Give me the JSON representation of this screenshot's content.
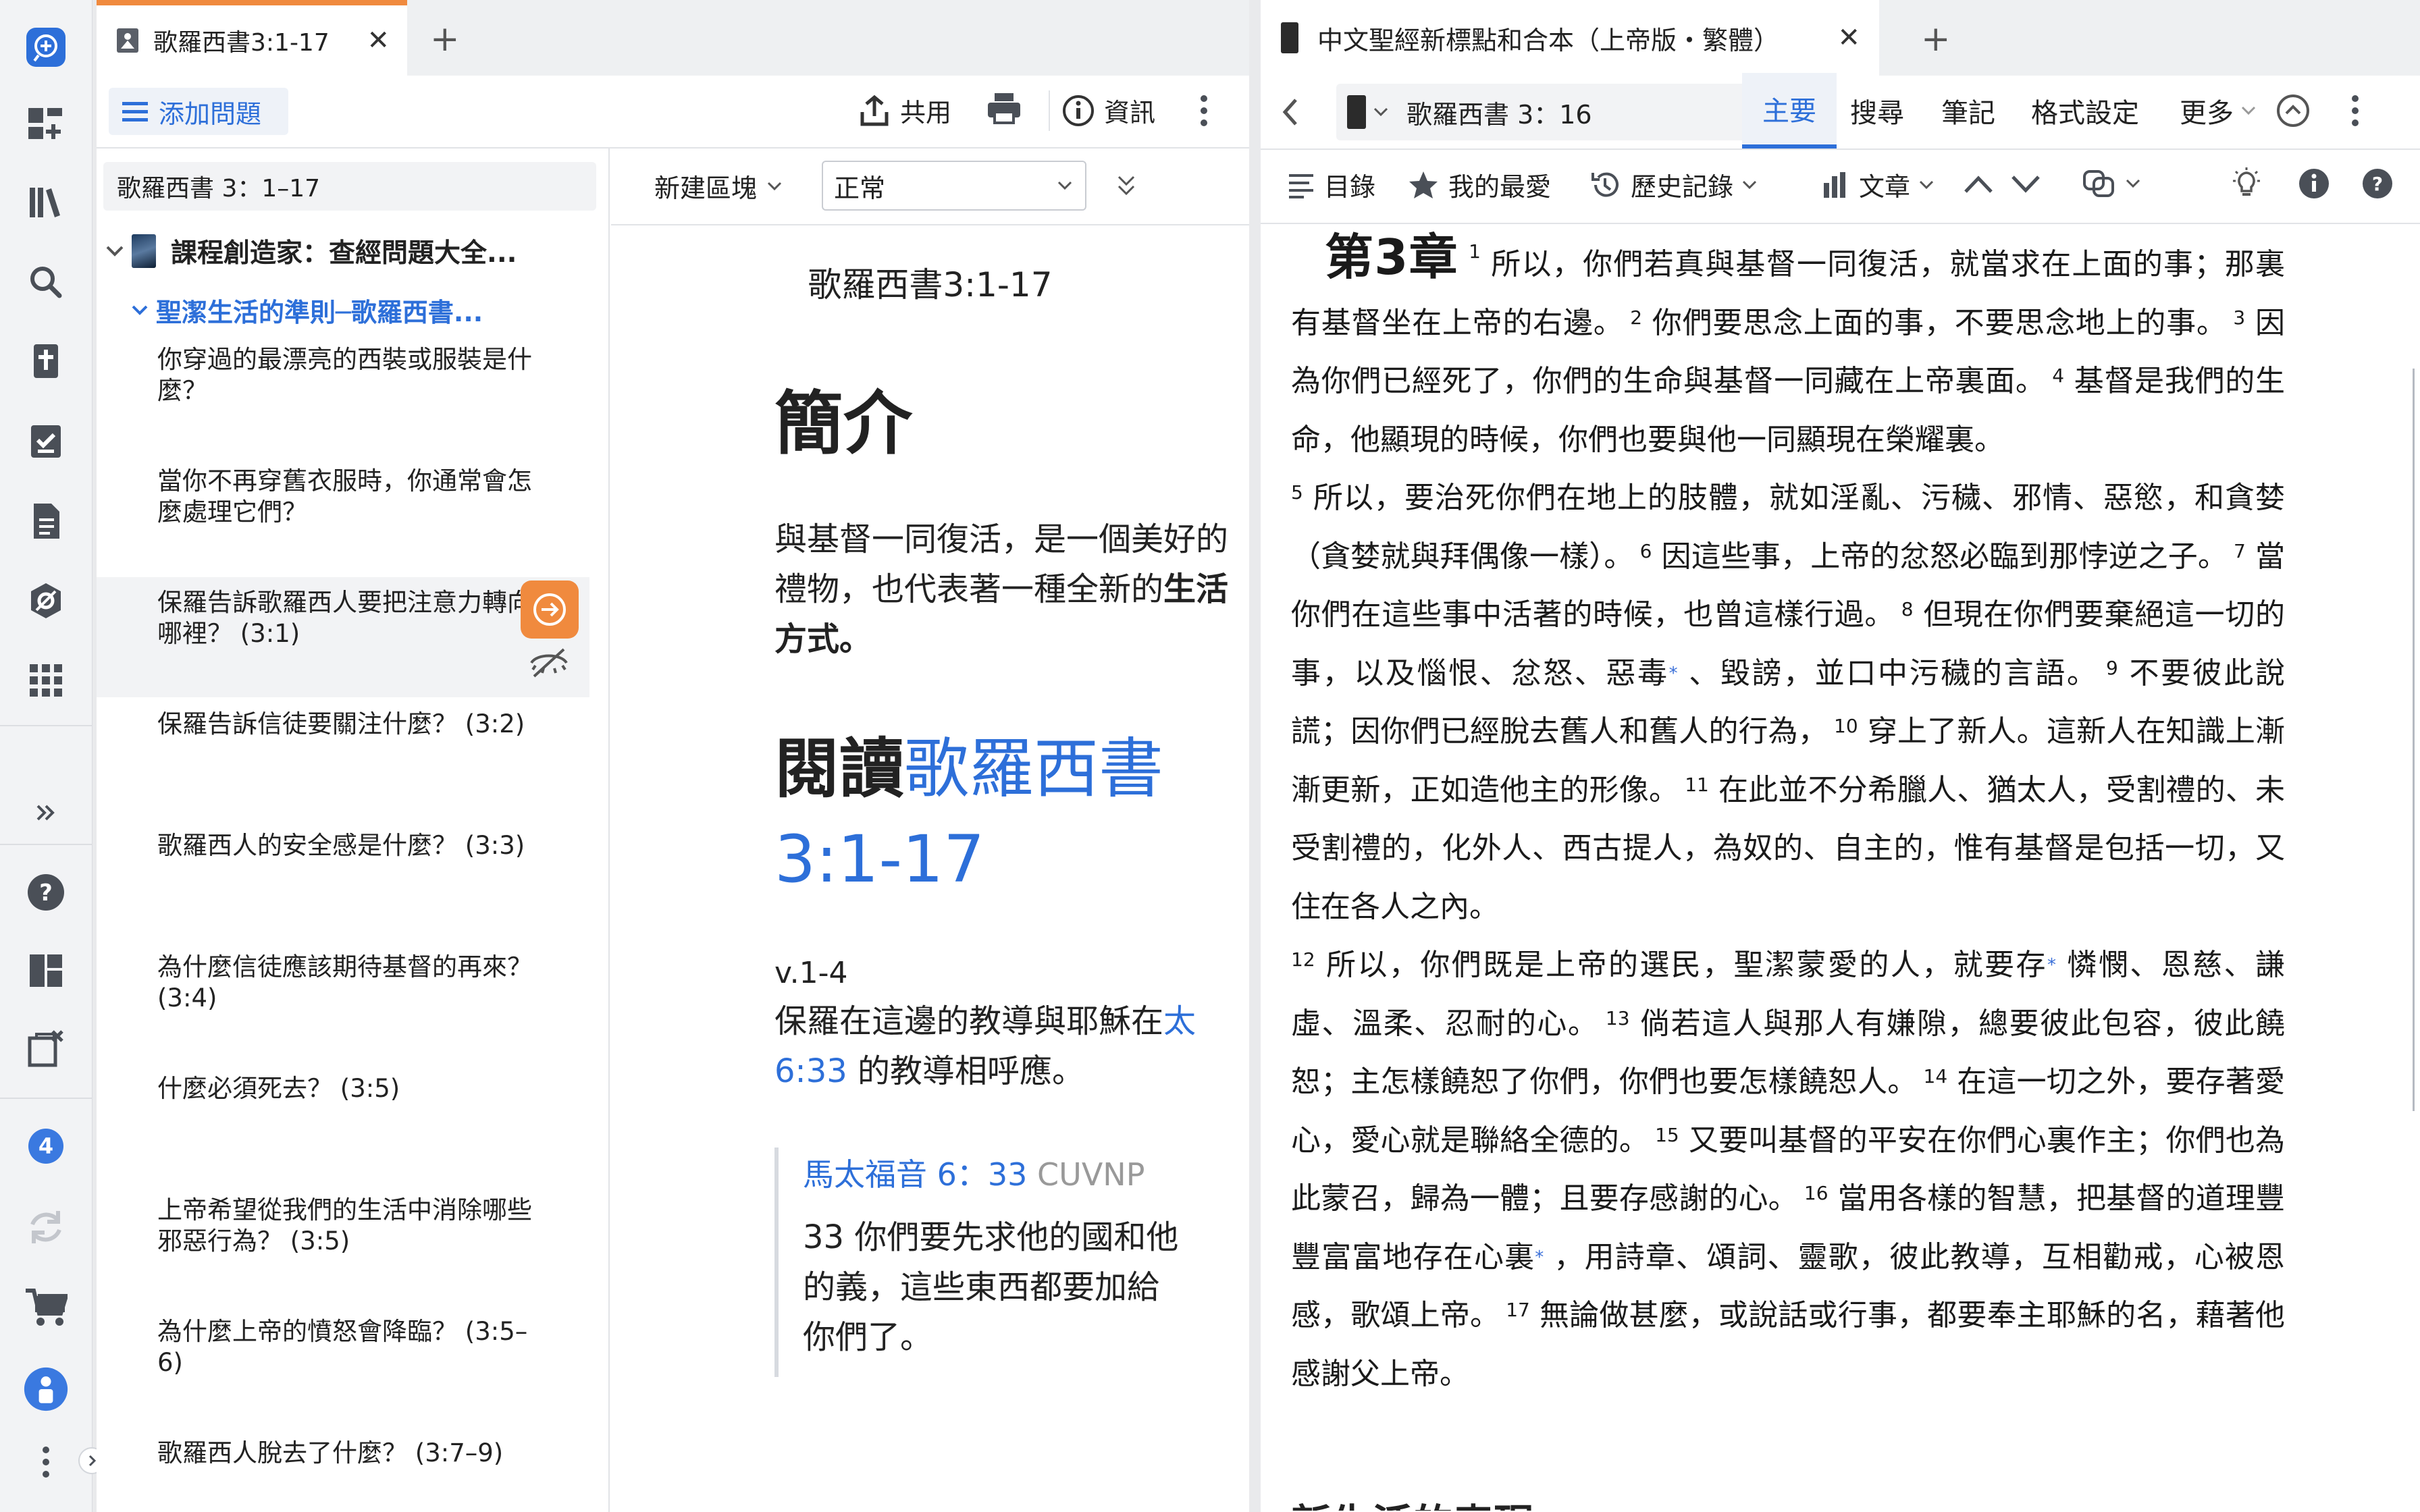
{
  "rail": {
    "badge": "4"
  },
  "left_panel": {
    "tab": {
      "title": "歌羅西書3:1-17"
    },
    "toolbar": {
      "add_question": "添加問題",
      "share": "共用",
      "info": "資訊"
    },
    "outline": {
      "search_value": "歌羅西書 3：1–17",
      "course": "課程創造家：查經問題大全...",
      "section": "聖潔生活的準則─歌羅西書...",
      "questions": [
        {
          "text": "你穿過的最漂亮的西裝或服裝是什麼？"
        },
        {
          "text": "當你不再穿舊衣服時，你通常會怎麼處理它們？"
        },
        {
          "text": "保羅告訴歌羅西人要把注意力轉向哪裡？ (3:1)"
        },
        {
          "text": "保羅告訴信徒要關注什麼？ (3:2)"
        },
        {
          "text": "歌羅西人的安全感是什麼？ (3:3)"
        },
        {
          "text": "為什麼信徒應該期待基督的再來？ (3:4)"
        },
        {
          "text": "什麼必須死去？ (3:5)"
        },
        {
          "text": "上帝希望從我們的生活中消除哪些邪惡行為？ (3:5)"
        },
        {
          "text": "為什麼上帝的憤怒會降臨？ (3:5–6)"
        },
        {
          "text": "歌羅西人脫去了什麼？ (3:7–9)"
        }
      ]
    },
    "doc": {
      "new_block": "新建區塊",
      "style_select": "正常",
      "title": "歌羅西書3:1-17",
      "intro_heading": "簡介",
      "intro_text": "與基督一同復活，是一個美好的禮物，也代表著一種全新的",
      "intro_bold": "生活方式。",
      "reading_prefix": "閱讀",
      "reading_link": "歌羅西書 3:1-17",
      "v_label": "v.1-4",
      "v_text": "保羅在這邊的教導與耶穌在",
      "v_link": "太 6:33",
      "v_text2": " 的教導相呼應。",
      "quote_ref": "馬太福音 6：33",
      "quote_ver": "CUVNP",
      "quote_text": "33 你們要先求他的國和他的義，這些東西都要加給你們了。"
    }
  },
  "right_panel": {
    "tab": {
      "title": "中文聖經新標點和合本（上帝版・繁體）"
    },
    "nav": {
      "reference": "歌羅西書 3：16",
      "tabs": [
        "主要",
        "搜尋",
        "筆記",
        "格式設定",
        "更多"
      ],
      "active_tab": "主要"
    },
    "toolbar2": {
      "toc": "目錄",
      "favorites": "我的最愛",
      "history": "歷史記錄",
      "text": "文章"
    },
    "chapter_label": "第3章",
    "verse_parts": [
      {
        "n": "1",
        "t": "所以，你們若真與基督一同復活，就當求在上面的事；那裏有基督坐在上帝的右邊。"
      },
      {
        "n": "2",
        "t": "你們要思念上面的事，不要思念地上的事。"
      },
      {
        "n": "3",
        "t": "因為你們已經死了，你們的生命與基督一同藏在上帝裏面。"
      },
      {
        "n": "4",
        "t": "基督是我們的生命，他顯現的時候，你們也要與他一同顯現在榮耀裏。"
      },
      {
        "n": "5",
        "t": "所以，要治死你們在地上的肢體，就如淫亂、污穢、邪情、惡慾，和貪婪（貪婪就與拜偶像一樣）。"
      },
      {
        "n": "6",
        "t": "因這些事，上帝的忿怒必臨到那悖逆之子。"
      },
      {
        "n": "7",
        "t": "當你們在這些事中活著的時候，也曾這樣行過。"
      },
      {
        "n": "8",
        "t": "但現在你們要棄絕這一切的事，以及惱恨、忿怒、惡毒"
      },
      {
        "n": "",
        "t": "、毀謗，並口中污穢的言語。"
      },
      {
        "n": "9",
        "t": "不要彼此說謊；因你們已經脫去舊人和舊人的行為，"
      },
      {
        "n": "10",
        "t": "穿上了新人。這新人在知識上漸漸更新，正如造他主的形像。"
      },
      {
        "n": "11",
        "t": "在此並不分希臘人、猶太人，受割禮的、未受割禮的，化外人、西古提人，為奴的、自主的，惟有基督是包括一切，又住在各人之內。"
      },
      {
        "n": "12",
        "t": "所以，你們既是上帝的選民，聖潔蒙愛的人，就要存"
      },
      {
        "n": "",
        "t": "憐憫、恩慈、謙虛、溫柔、忍耐的心。"
      },
      {
        "n": "13",
        "t": "倘若這人與那人有嫌隙，總要彼此包容，彼此饒恕；主怎樣饒恕了你們，你們也要怎樣饒恕人。"
      },
      {
        "n": "14",
        "t": "在這一切之外，要存著愛心，愛心就是聯絡全德的。"
      },
      {
        "n": "15",
        "t": "又要叫基督的平安在你們心裏作主；你們也為此蒙召，歸為一體；且要存感謝的心。"
      },
      {
        "n": "16",
        "t": "當用各樣的智慧，把基督的道理豐豐富富地存在心裏"
      },
      {
        "n": "",
        "t": "，用詩章、頌詞、靈歌，彼此教導，互相勸戒，心被恩感，歌頌上帝。"
      },
      {
        "n": "17",
        "t": "無論做甚麼，或說話或行事，都要奉主耶穌的名，藉著他感謝父上帝。"
      }
    ],
    "next_heading": "新生活的表現"
  }
}
